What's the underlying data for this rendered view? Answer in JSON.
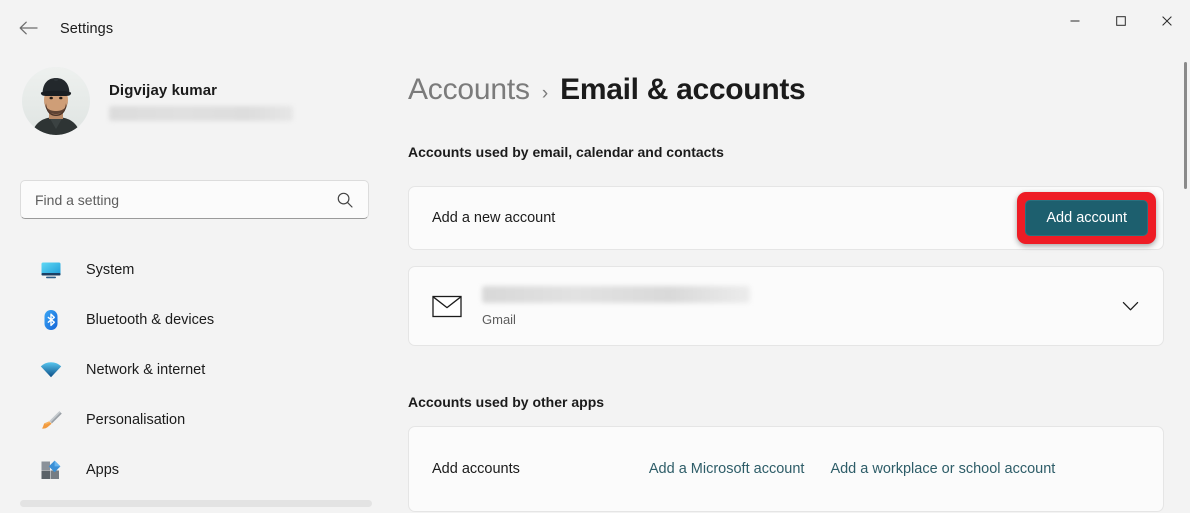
{
  "window": {
    "app_title": "Settings",
    "back_icon": "back-arrow-icon",
    "minimize_label": "—",
    "maximize_label": "□",
    "close_label": "✕"
  },
  "sidebar": {
    "profile": {
      "name": "Digvijay kumar",
      "email_redacted": true,
      "avatar_alt": "user-avatar"
    },
    "search": {
      "placeholder": "Find a setting",
      "value": "",
      "icon": "search-icon"
    },
    "items": [
      {
        "label": "System",
        "icon": "monitor-icon"
      },
      {
        "label": "Bluetooth & devices",
        "icon": "bluetooth-icon"
      },
      {
        "label": "Network & internet",
        "icon": "wifi-icon"
      },
      {
        "label": "Personalisation",
        "icon": "paintbrush-icon"
      },
      {
        "label": "Apps",
        "icon": "apps-icon"
      }
    ]
  },
  "main": {
    "breadcrumb": {
      "parent": "Accounts",
      "separator": "›",
      "current": "Email & accounts"
    },
    "sections": [
      {
        "label": "Accounts used by email, calendar and contacts",
        "add_row": {
          "title": "Add a new account",
          "button_label": "Add account",
          "highlighted": true
        },
        "accounts": [
          {
            "name_redacted": true,
            "provider": "Gmail",
            "icon": "envelope-icon",
            "expand_icon": "chevron-down-icon"
          }
        ]
      },
      {
        "label": "Accounts used by other apps",
        "add_accounts_label": "Add accounts",
        "links": [
          "Add a Microsoft account",
          "Add a workplace or school account"
        ]
      }
    ]
  },
  "colors": {
    "window_bg": "#f3f3f3",
    "card_bg": "#fbfbfb",
    "accent_button": "#1d5f6e",
    "highlight_annotation": "#ee1c25",
    "link": "#2e5d68"
  }
}
